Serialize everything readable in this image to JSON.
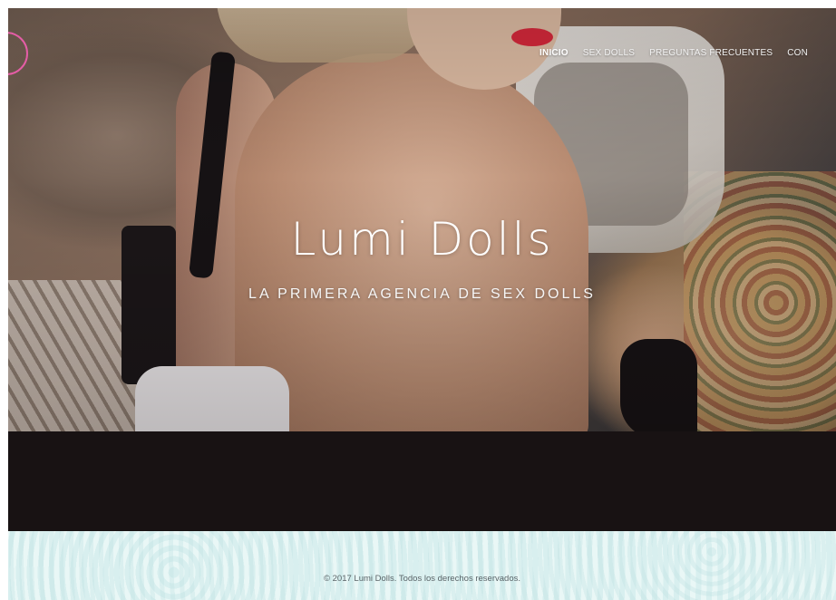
{
  "nav": {
    "items": [
      {
        "label": "INICIO",
        "active": true
      },
      {
        "label": "SEX DOLLS",
        "active": false
      },
      {
        "label": "PREGUNTAS FRECUENTES",
        "active": false
      },
      {
        "label": "CON",
        "active": false
      }
    ]
  },
  "hero": {
    "title": "Lumi Dolls",
    "subtitle": "LA PRIMERA AGENCIA DE SEX DOLLS"
  },
  "footer": {
    "copyright": "© 2017 Lumi Dolls. Todos los derechos reservados."
  },
  "colors": {
    "accent": "#e45da6",
    "dark_band": "#181213",
    "footer_bg": "#e4f4f3"
  }
}
